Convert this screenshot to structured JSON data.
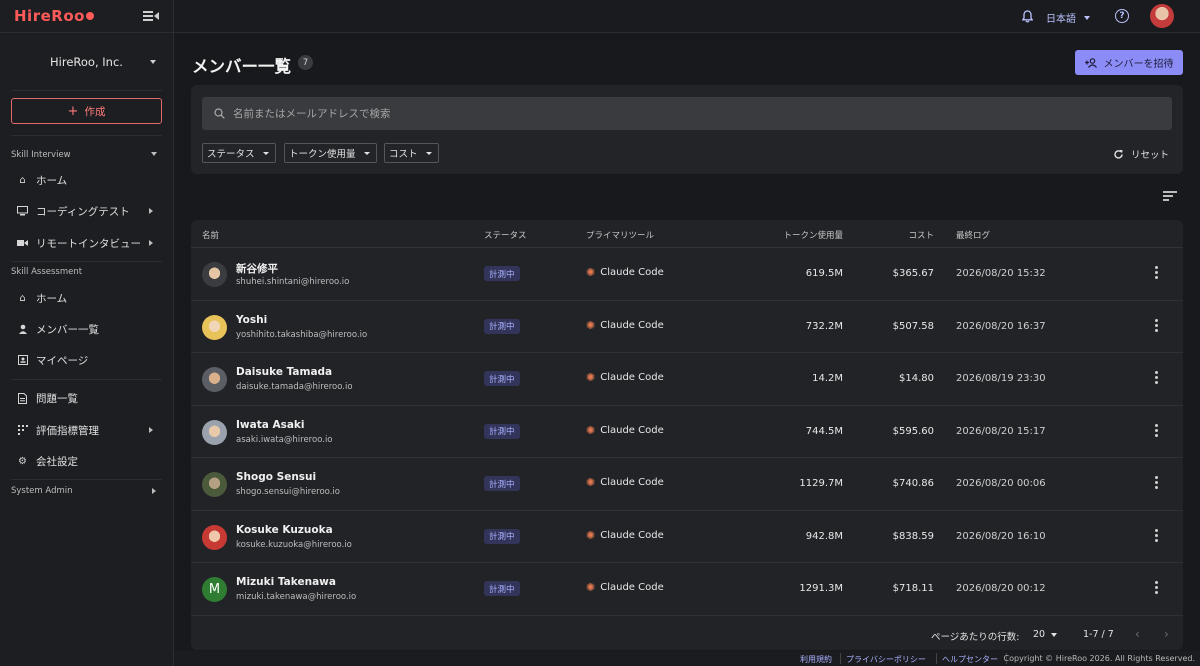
{
  "app": {
    "logo": "HireRoo"
  },
  "sidebar": {
    "org_name": "HireRoo, Inc.",
    "create_label": "作成",
    "section_skill_interview": "Skill Interview",
    "skill_interview_items": [
      {
        "label": "ホーム",
        "icon": "home-icon"
      },
      {
        "label": "コーディングテスト",
        "icon": "monitor-icon"
      },
      {
        "label": "リモートインタビュー",
        "icon": "video-icon"
      }
    ],
    "section_skill_assessment": "Skill Assessment",
    "skill_assessment_items": [
      {
        "label": "ホーム",
        "icon": "home-icon"
      },
      {
        "label": "メンバー一覧",
        "icon": "person-icon"
      },
      {
        "label": "マイページ",
        "icon": "id-card-icon"
      }
    ],
    "other_items": [
      {
        "label": "問題一覧",
        "icon": "document-icon"
      },
      {
        "label": "評価指標管理",
        "icon": "metrics-icon"
      },
      {
        "label": "会社設定",
        "icon": "gear-icon"
      }
    ],
    "section_system_admin": "System Admin"
  },
  "topbar": {
    "language": "日本語",
    "help_symbol": "?"
  },
  "main": {
    "title": "メンバー一覧",
    "member_count": "7",
    "invite_label": "メンバーを招待",
    "search_placeholder": "名前またはメールアドレスで検索",
    "filters": [
      "ステータス",
      "トークン使用量",
      "コスト"
    ],
    "reset_label": "リセット"
  },
  "table": {
    "headers": {
      "name": "名前",
      "status": "ステータス",
      "primary_tool": "プライマリツール",
      "tokens": "トークン使用量",
      "cost": "コスト",
      "last_log": "最終ログ"
    },
    "rows": [
      {
        "name": "新谷修平",
        "email": "shuhei.shintani@hireroo.io",
        "status": "計測中",
        "tool": "Claude Code",
        "tokens": "619.5M",
        "cost": "$365.67",
        "last_log": "2026/08/20 15:32"
      },
      {
        "name": "Yoshi",
        "email": "yoshihito.takashiba@hireroo.io",
        "status": "計測中",
        "tool": "Claude Code",
        "tokens": "732.2M",
        "cost": "$507.58",
        "last_log": "2026/08/20 16:37"
      },
      {
        "name": "Daisuke Tamada",
        "email": "daisuke.tamada@hireroo.io",
        "status": "計測中",
        "tool": "Claude Code",
        "tokens": "14.2M",
        "cost": "$14.80",
        "last_log": "2026/08/19 23:30"
      },
      {
        "name": "Iwata Asaki",
        "email": "asaki.iwata@hireroo.io",
        "status": "計測中",
        "tool": "Claude Code",
        "tokens": "744.5M",
        "cost": "$595.60",
        "last_log": "2026/08/20 15:17"
      },
      {
        "name": "Shogo Sensui",
        "email": "shogo.sensui@hireroo.io",
        "status": "計測中",
        "tool": "Claude Code",
        "tokens": "1129.7M",
        "cost": "$740.86",
        "last_log": "2026/08/20 00:06"
      },
      {
        "name": "Kosuke Kuzuoka",
        "email": "kosuke.kuzuoka@hireroo.io",
        "status": "計測中",
        "tool": "Claude Code",
        "tokens": "942.8M",
        "cost": "$838.59",
        "last_log": "2026/08/20 16:10"
      },
      {
        "name": "Mizuki Takenawa",
        "email": "mizuki.takenawa@hireroo.io",
        "status": "計測中",
        "tool": "Claude Code",
        "tokens": "1291.3M",
        "cost": "$718.11",
        "last_log": "2026/08/20 00:12",
        "avatar_letter": "M"
      }
    ],
    "pagination": {
      "rows_per_page_label": "ページあたりの行数:",
      "rows_per_page": "20",
      "range": "1-7 / 7"
    }
  },
  "footer": {
    "terms": "利用規約",
    "privacy": "プライバシーポリシー",
    "help_center": "ヘルプセンター",
    "copyright": "Copyright © HireRoo 2026. All Rights Reserved."
  },
  "colors": {
    "accent": "#8c8cf6",
    "brand_red": "#ff5a5a",
    "status_bg": "#33345a",
    "status_text": "#a9b1ff"
  }
}
